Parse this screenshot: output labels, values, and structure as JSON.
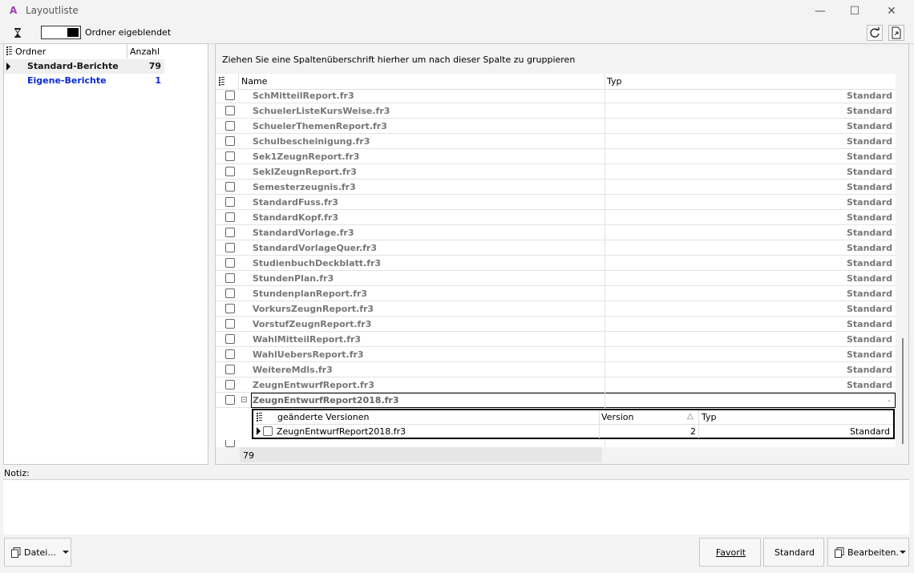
{
  "window": {
    "title": "Layoutliste"
  },
  "toolbar": {
    "toggle_label": "Ordner eigeblendet"
  },
  "folders": {
    "header": {
      "name": "Ordner",
      "count": "Anzahl"
    },
    "items": [
      {
        "name": "Standard-Berichte",
        "count": "79",
        "color": "#1a1a1a"
      },
      {
        "name": "Eigene-Berichte",
        "count": "1",
        "color": "#0a2bd6"
      }
    ]
  },
  "grid": {
    "group_hint": "Ziehen Sie eine Spaltenüberschrift hierher um nach dieser Spalte zu gruppieren",
    "columns": {
      "name": "Name",
      "typ": "Typ"
    },
    "rows": [
      {
        "name": "SchMitteilReport.fr3",
        "typ": "Standard"
      },
      {
        "name": "SchuelerListeKursWeise.fr3",
        "typ": "Standard"
      },
      {
        "name": "SchuelerThemenReport.fr3",
        "typ": "Standard"
      },
      {
        "name": "Schulbescheinigung.fr3",
        "typ": "Standard"
      },
      {
        "name": "Sek1ZeugnReport.fr3",
        "typ": "Standard"
      },
      {
        "name": "SekIZeugnReport.fr3",
        "typ": "Standard"
      },
      {
        "name": "Semesterzeugnis.fr3",
        "typ": "Standard"
      },
      {
        "name": "StandardFuss.fr3",
        "typ": "Standard"
      },
      {
        "name": "StandardKopf.fr3",
        "typ": "Standard"
      },
      {
        "name": "StandardVorlage.fr3",
        "typ": "Standard"
      },
      {
        "name": "StandardVorlageQuer.fr3",
        "typ": "Standard"
      },
      {
        "name": "StudienbuchDeckblatt.fr3",
        "typ": "Standard"
      },
      {
        "name": "StundenPlan.fr3",
        "typ": "Standard"
      },
      {
        "name": "StundenplanReport.fr3",
        "typ": "Standard"
      },
      {
        "name": "VorkursZeugnReport.fr3",
        "typ": "Standard"
      },
      {
        "name": "VorstufZeugnReport.fr3",
        "typ": "Standard"
      },
      {
        "name": "WahlMitteilReport.fr3",
        "typ": "Standard"
      },
      {
        "name": "WahlUebersReport.fr3",
        "typ": "Standard"
      },
      {
        "name": "WeitereMdls.fr3",
        "typ": "Standard"
      },
      {
        "name": "ZeugnEntwurfReport.fr3",
        "typ": "Standard"
      }
    ],
    "expanded_row": {
      "name": "ZeugnEntwurfReport2018.fr3",
      "typ": "-"
    },
    "detail": {
      "columns": {
        "name": "geänderte Versionen",
        "version": "Version",
        "typ": "Typ"
      },
      "row": {
        "name": "ZeugnEntwurfReport2018.fr3",
        "version": "2",
        "typ": "Standard"
      }
    },
    "footer_count": "79"
  },
  "notiz": {
    "label": "Notiz:"
  },
  "buttons": {
    "datei": "Datei...",
    "favorit": "Favorit",
    "standard": "Standard",
    "bearbeiten": "Bearbeiten."
  }
}
